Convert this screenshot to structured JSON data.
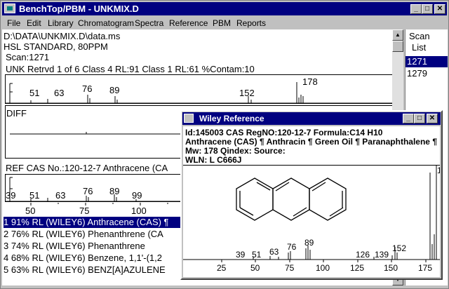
{
  "window": {
    "title": "BenchTop/PBM - UNKMIX.D"
  },
  "menu": [
    "File",
    "Edit",
    "Library",
    "Chromatogram",
    "Spectra",
    "Reference",
    "PBM",
    "Reports"
  ],
  "header": {
    "path": "D:\\DATA\\UNKMIX.D\\data.ms",
    "sample": "HSL STANDARD, 80PPM",
    "scan": "Scan:1271",
    "summary": "UNK  Retrvd  1  of  6   Class 4 RL:91   Class 1 RL:61   %Contam:10"
  },
  "unk_spectrum": {
    "peak_labels": [
      "51",
      "63",
      "76",
      "89",
      "152",
      "178"
    ]
  },
  "diff_label": "DIFF",
  "ref_header": "REF  CAS No.:120-12-7  Anthracene (CA",
  "ref_spectrum": {
    "peak_labels": [
      "39",
      "51",
      "63",
      "76",
      "89",
      "99"
    ]
  },
  "axis": {
    "ticks": [
      "50",
      "75",
      "100"
    ]
  },
  "hits": [
    "1 91% RL (WILEY6) Anthracene (CAS) ¶",
    "2 76% RL (WILEY6) Phenanthrene (CA",
    "3 74% RL (WILEY6) Phenanthrene",
    "4 68% RL (WILEY6) Benzene, 1,1'-(1,2",
    "5 63% RL (WILEY6) BENZ[A]AZULENE"
  ],
  "scan_list": {
    "title1": "Scan",
    "title2": "List",
    "items": [
      "1271",
      "1279"
    ],
    "selected": 0
  },
  "wiley": {
    "title": "Wiley Reference",
    "line1": "Id:145003   CAS RegNO:120-12-7    Formula:C14 H10",
    "line2": "Anthracene (CAS) ¶ Anthracin ¶ Green Oil ¶ Paranaphthalene ¶",
    "line3": "Mw:  178    Qindex:     Source:",
    "line4": "WLN: L C666J",
    "peak_labels": [
      "39",
      "51",
      "63",
      "76",
      "89",
      "126",
      "139",
      "152"
    ],
    "axis_ticks": [
      "25",
      "50",
      "75",
      "100",
      "125",
      "150",
      "175"
    ],
    "side_label": "1"
  },
  "colors": {
    "titlebar": "#000080",
    "selection": "#000080"
  }
}
